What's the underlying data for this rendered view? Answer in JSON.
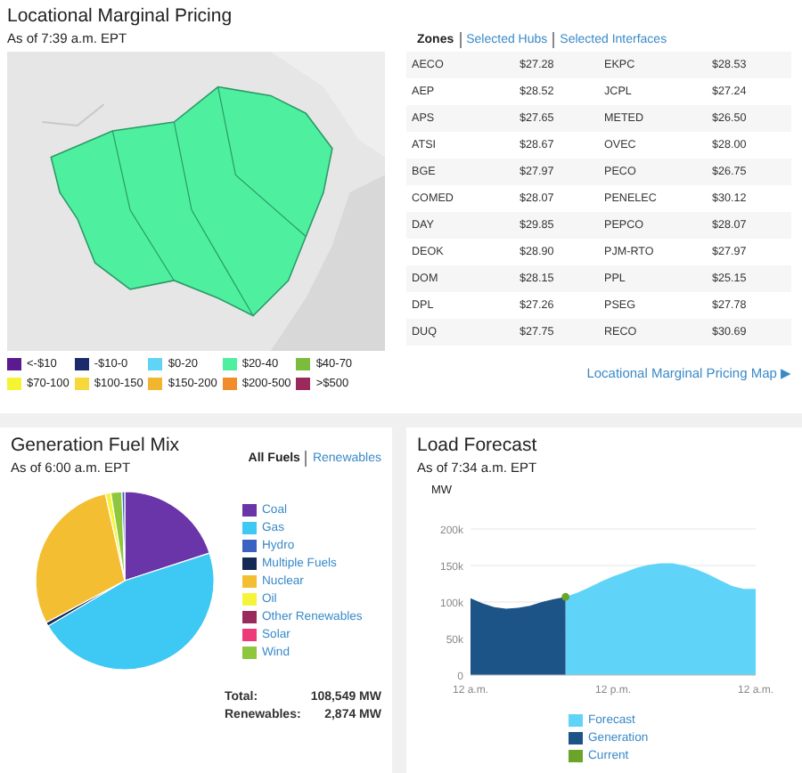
{
  "lmp": {
    "title": "Locational Marginal Pricing",
    "as_of": "As of 7:39 a.m. EPT",
    "tabs": [
      {
        "label": "Zones",
        "selected": true
      },
      {
        "label": "Selected Hubs",
        "selected": false
      },
      {
        "label": "Selected Interfaces",
        "selected": false
      }
    ],
    "rows": [
      [
        "AECO",
        "$27.28",
        "EKPC",
        "$28.53"
      ],
      [
        "AEP",
        "$28.52",
        "JCPL",
        "$27.24"
      ],
      [
        "APS",
        "$27.65",
        "METED",
        "$26.50"
      ],
      [
        "ATSI",
        "$28.67",
        "OVEC",
        "$28.00"
      ],
      [
        "BGE",
        "$27.97",
        "PECO",
        "$26.75"
      ],
      [
        "COMED",
        "$28.07",
        "PENELEC",
        "$30.12"
      ],
      [
        "DAY",
        "$29.85",
        "PEPCO",
        "$28.07"
      ],
      [
        "DEOK",
        "$28.90",
        "PJM-RTO",
        "$27.97"
      ],
      [
        "DOM",
        "$28.15",
        "PPL",
        "$25.15"
      ],
      [
        "DPL",
        "$27.26",
        "PSEG",
        "$27.78"
      ],
      [
        "DUQ",
        "$27.75",
        "RECO",
        "$30.69"
      ]
    ],
    "legend": [
      {
        "label": "<-$10",
        "color": "#5b1a8e"
      },
      {
        "label": "-$10-0",
        "color": "#1b2a6b"
      },
      {
        "label": "$0-20",
        "color": "#5fd4f4"
      },
      {
        "label": "$20-40",
        "color": "#4ef0a0"
      },
      {
        "label": "$40-70",
        "color": "#7cbb3e"
      },
      {
        "label": "$70-100",
        "color": "#f4f432"
      },
      {
        "label": "$100-150",
        "color": "#f6d83a"
      },
      {
        "label": "$150-200",
        "color": "#f2b62e"
      },
      {
        "label": "$200-500",
        "color": "#f08c2a"
      },
      {
        "label": ">$500",
        "color": "#9a2a5e"
      }
    ],
    "map_link": "Locational Marginal Pricing Map ▶"
  },
  "fuel_mix": {
    "title": "Generation Fuel Mix",
    "as_of": "As of 6:00 a.m. EPT",
    "tabs": [
      {
        "label": "All Fuels",
        "selected": true
      },
      {
        "label": "Renewables",
        "selected": false
      }
    ],
    "legend": [
      {
        "label": "Coal",
        "color": "#6a35a8"
      },
      {
        "label": "Gas",
        "color": "#3ec8f4"
      },
      {
        "label": "Hydro",
        "color": "#3a62c0"
      },
      {
        "label": "Multiple Fuels",
        "color": "#142a54"
      },
      {
        "label": "Nuclear",
        "color": "#f3be32"
      },
      {
        "label": "Oil",
        "color": "#f6f43a"
      },
      {
        "label": "Other Renewables",
        "color": "#9a2a5e"
      },
      {
        "label": "Solar",
        "color": "#ee3a78"
      },
      {
        "label": "Wind",
        "color": "#8ec63e"
      }
    ],
    "totals": [
      {
        "label": "Total:",
        "value": "108,549 MW"
      },
      {
        "label": "Renewables:",
        "value": "2,874 MW"
      }
    ]
  },
  "load_forecast": {
    "title": "Load Forecast",
    "as_of": "As of 7:34 a.m. EPT",
    "chart_data": {
      "type": "area",
      "ylabel": "MW",
      "categories": [
        "12 a.m.",
        null,
        null,
        null,
        null,
        null,
        null,
        null,
        null,
        null,
        null,
        null,
        "12 p.m.",
        null,
        null,
        null,
        null,
        null,
        null,
        null,
        null,
        null,
        null,
        null,
        "12 a.m."
      ],
      "yticks": [
        {
          "value": 0,
          "label": "0"
        },
        {
          "value": 50000,
          "label": "50k"
        },
        {
          "value": 100000,
          "label": "100k"
        },
        {
          "value": 150000,
          "label": "150k"
        },
        {
          "value": 200000,
          "label": "200k"
        }
      ],
      "ylim": [
        0,
        200000
      ],
      "series": [
        {
          "name": "Forecast",
          "color": "#5fd4f8",
          "values": [
            null,
            null,
            null,
            null,
            null,
            null,
            null,
            null,
            107000,
            113000,
            120000,
            128000,
            135000,
            141000,
            147000,
            151000,
            153000,
            153000,
            150000,
            145000,
            138000,
            130000,
            122000,
            118000,
            118000
          ]
        },
        {
          "name": "Generation",
          "color": "#1d5488",
          "values": [
            105000,
            98000,
            93000,
            91000,
            92000,
            95000,
            100000,
            104000,
            107000,
            null,
            null,
            null,
            null,
            null,
            null,
            null,
            null,
            null,
            null,
            null,
            null,
            null,
            null,
            null,
            null
          ]
        }
      ]
    },
    "current_marker": {
      "label": "Current",
      "color": "#6aa52a"
    }
  }
}
